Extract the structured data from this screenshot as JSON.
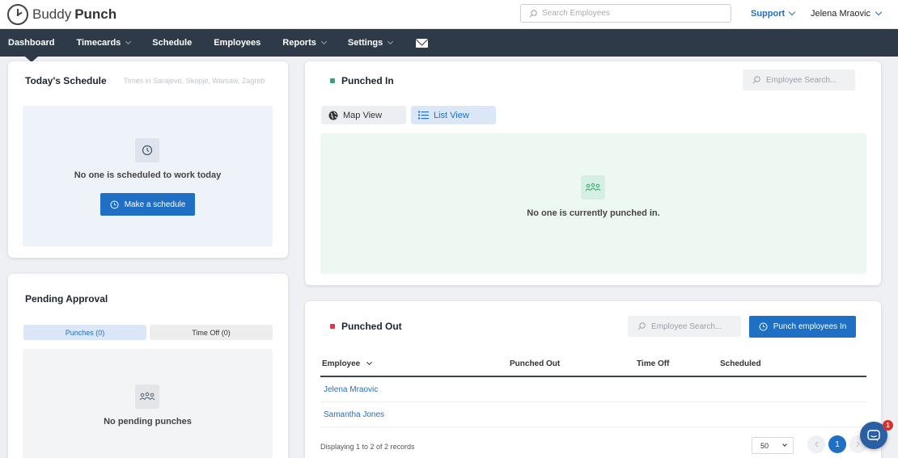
{
  "brand": {
    "name_part1": "Buddy",
    "name_part2": "Punch"
  },
  "header": {
    "search_placeholder": "Search Employees",
    "support_label": "Support",
    "user_name": "Jelena Mraovic"
  },
  "nav": {
    "items": [
      {
        "label": "Dashboard"
      },
      {
        "label": "Timecards"
      },
      {
        "label": "Schedule"
      },
      {
        "label": "Employees"
      },
      {
        "label": "Reports"
      },
      {
        "label": "Settings"
      }
    ]
  },
  "schedule": {
    "title": "Today's Schedule",
    "timezone": "Times in Sarajevo, Skopje, Warsaw, Zagreb",
    "empty_text": "No one is scheduled to work today",
    "button_label": "Make a schedule"
  },
  "pending": {
    "title": "Pending Approval",
    "tab_punches": "Punches (0)",
    "tab_timeoff": "Time Off (0)",
    "empty_text": "No pending punches"
  },
  "punched_in": {
    "title": "Punched In",
    "search_placeholder": "Employee Search...",
    "map_view": "Map View",
    "list_view": "List View",
    "empty_text": "No one is currently punched in.",
    "status_color": "#2fa86e"
  },
  "punched_out": {
    "title": "Punched Out",
    "search_placeholder": "Employee Search...",
    "button_label": "Punch employees In",
    "status_color": "#e0394a",
    "columns": [
      "Employee",
      "Punched Out",
      "Time Off",
      "Scheduled"
    ],
    "rows": [
      {
        "employee": "Jelena Mraovic"
      },
      {
        "employee": "Samantha Jones"
      }
    ],
    "footer_text": "Displaying 1 to 2 of 2 records",
    "page_size": "50",
    "current_page": "1"
  },
  "chat": {
    "badge": "1"
  },
  "colors": {
    "accent": "#1f6fc5",
    "nav_bg": "#2f3a48"
  }
}
